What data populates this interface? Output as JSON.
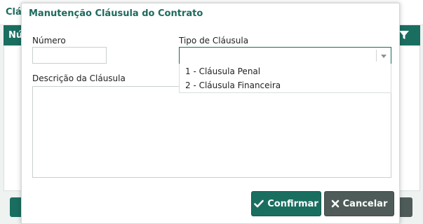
{
  "background": {
    "title": "Clá",
    "grid_first_column": "Nú"
  },
  "modal": {
    "title": "Manutenção Cláusula do Contrato",
    "fields": {
      "numero": {
        "label": "Número",
        "value": ""
      },
      "tipo": {
        "label": "Tipo de Cláusula",
        "value": "",
        "options": [
          "1 - Cláusula Penal",
          "2 - Cláusula Financeira"
        ]
      },
      "descricao": {
        "label": "Descrição da Cláusula",
        "value": ""
      }
    },
    "buttons": {
      "confirm": "Confirmar",
      "cancel": "Cancelar"
    }
  },
  "colors": {
    "primary": "#1a6e60",
    "secondary": "#4e5b58",
    "title_text": "#1d6b5e"
  }
}
